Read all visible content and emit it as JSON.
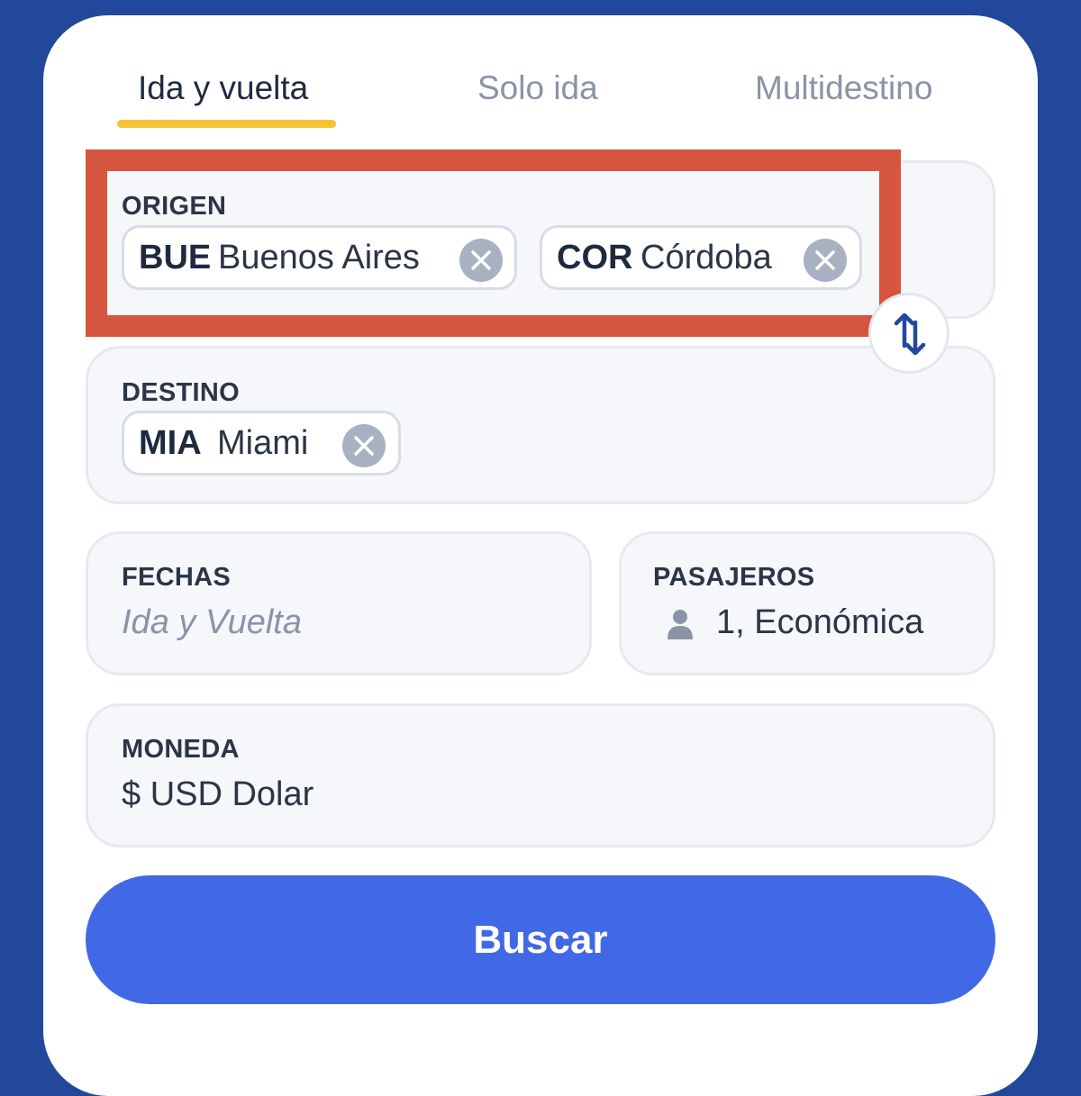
{
  "tabs": [
    {
      "label": "Ida y vuelta",
      "active": true
    },
    {
      "label": "Solo ida",
      "active": false
    },
    {
      "label": "Multidestino",
      "active": false
    }
  ],
  "origin": {
    "label": "ORIGEN",
    "chips": [
      {
        "code": "BUE",
        "city": "Buenos Aires"
      },
      {
        "code": "COR",
        "city": "Córdoba"
      }
    ]
  },
  "destination": {
    "label": "DESTINO",
    "chips": [
      {
        "code": "MIA",
        "city": "Miami"
      }
    ]
  },
  "dates": {
    "label": "FECHAS",
    "placeholder": "Ida y Vuelta"
  },
  "passengers": {
    "label": "PASAJEROS",
    "value": "1, Económica",
    "icon": "person-icon"
  },
  "currency": {
    "label": "MONEDA",
    "value": "$ USD Dolar"
  },
  "search_button": {
    "label": "Buscar"
  },
  "colors": {
    "background": "#21489a",
    "accent": "#4169e6",
    "tab_indicator": "#f5c334",
    "highlight_border": "#d5553f"
  }
}
